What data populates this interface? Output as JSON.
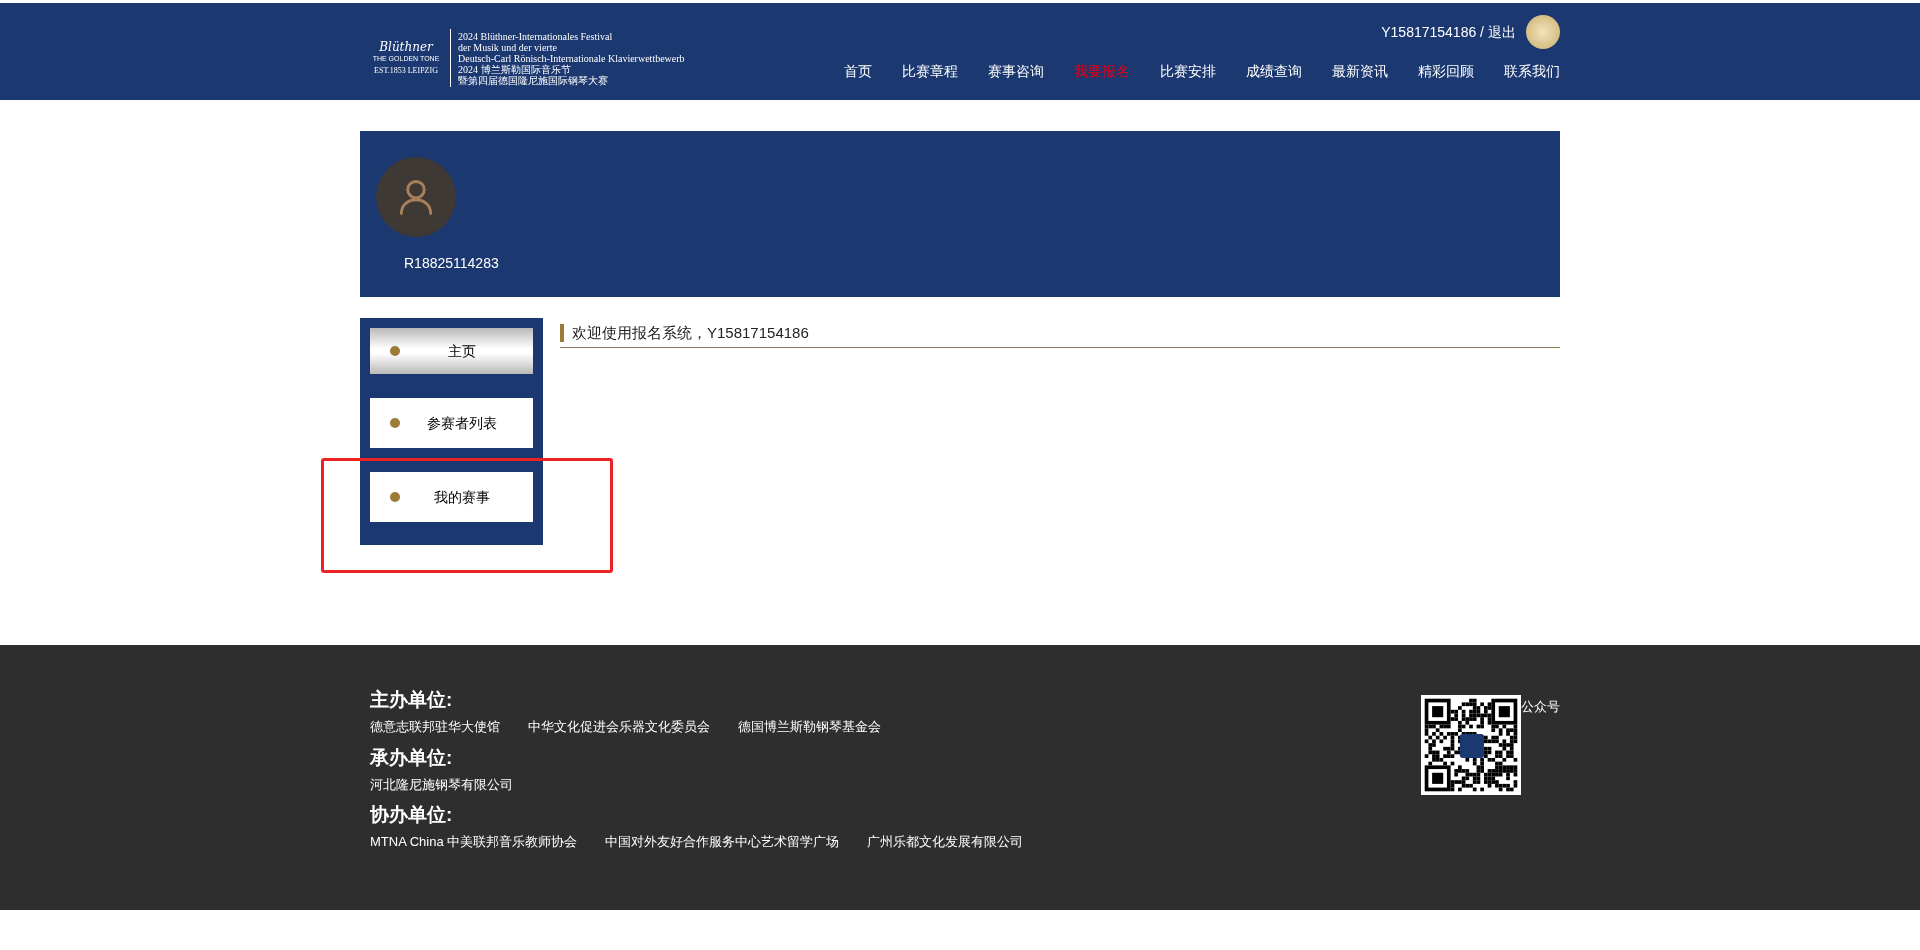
{
  "header": {
    "logo": {
      "brand": "Blüthner",
      "tagline": "THE GOLDEN TONE",
      "est": "EST.1853 LEIPZIG",
      "lines": [
        "2024 Blüthner-Internationales Festival",
        "der Musik und der vierte",
        "Deutsch-Carl Rönisch-Internationale Klavierwettbewerb",
        "2024 博兰斯勒国际音乐节",
        "暨第四届德国隆尼施国际钢琴大赛"
      ]
    },
    "user": {
      "name": "Y15817154186",
      "separator": "/",
      "logout": "退出"
    },
    "nav": [
      {
        "label": "首页",
        "selected": false
      },
      {
        "label": "比赛章程",
        "selected": false
      },
      {
        "label": "赛事咨询",
        "selected": false
      },
      {
        "label": "我要报名",
        "selected": true
      },
      {
        "label": "比赛安排",
        "selected": false
      },
      {
        "label": "成绩查询",
        "selected": false
      },
      {
        "label": "最新资讯",
        "selected": false
      },
      {
        "label": "精彩回顾",
        "selected": false
      },
      {
        "label": "联系我们",
        "selected": false
      }
    ]
  },
  "profile": {
    "username": "R18825114283"
  },
  "sidebar": {
    "items": [
      {
        "label": "主页",
        "selected": true
      },
      {
        "label": "参赛者列表",
        "selected": false
      },
      {
        "label": "我的赛事",
        "selected": false
      }
    ]
  },
  "welcome": "欢迎使用报名系统，Y15817154186",
  "footer": {
    "sections": [
      {
        "heading": "主办单位:",
        "items": [
          "德意志联邦驻华大使馆",
          "中华文化促进会乐器文化委员会",
          "德国博兰斯勒钢琴基金会"
        ]
      },
      {
        "heading": "承办单位:",
        "items": [
          "河北隆尼施钢琴有限公司"
        ]
      },
      {
        "heading": "协办单位:",
        "items": [
          "MTNA China 中美联邦音乐教师协会",
          "中国对外友好合作服务中心艺术留学广场",
          "广州乐都文化发展有限公司"
        ]
      }
    ],
    "qr_label": "公众号"
  }
}
